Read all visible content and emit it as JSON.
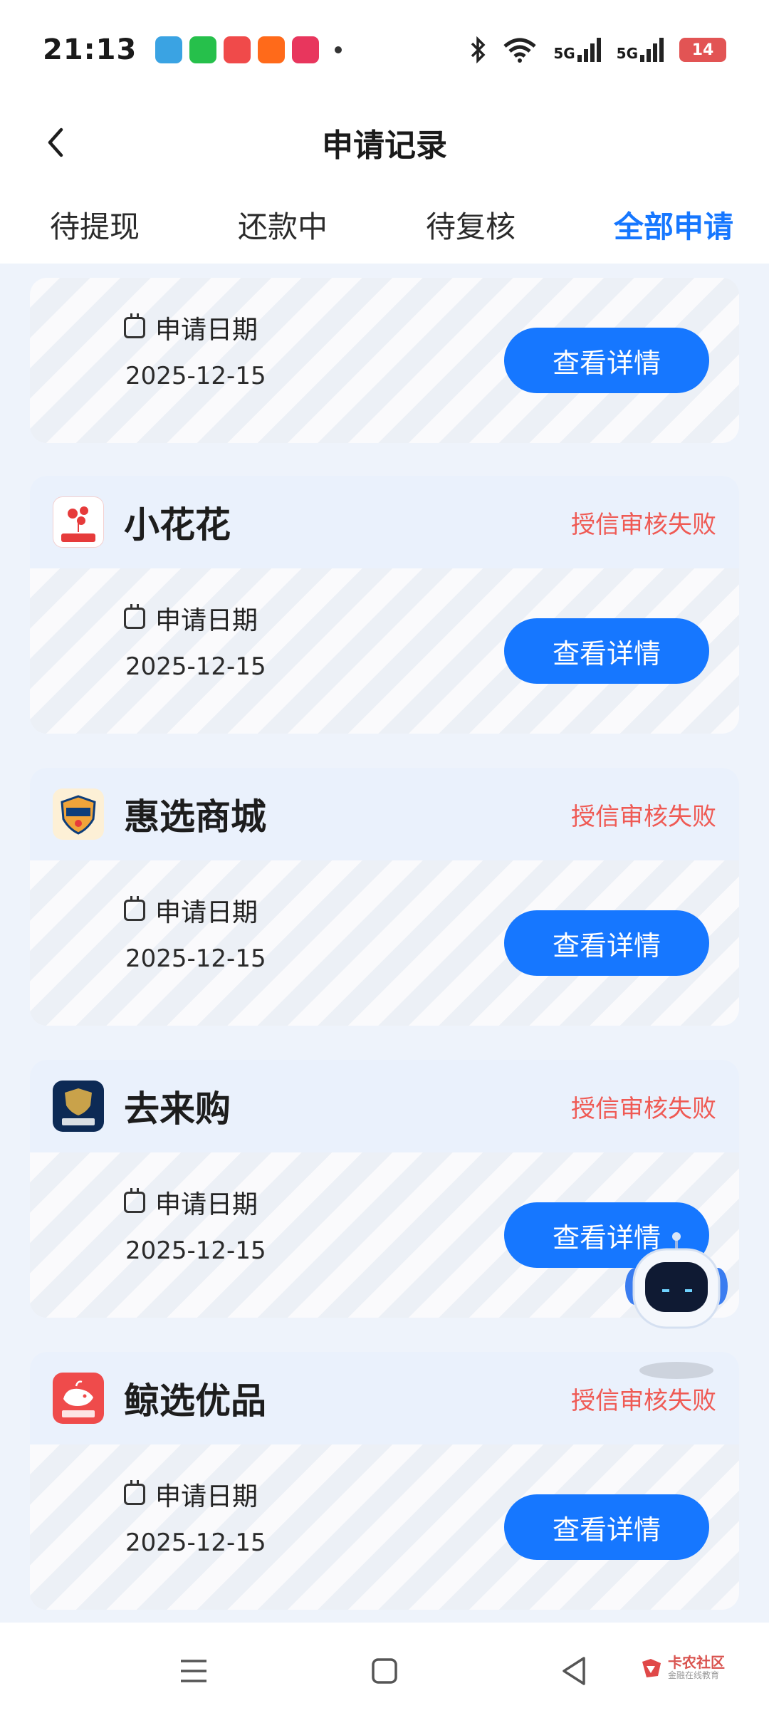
{
  "status_bar": {
    "time": "21:13",
    "network_1": "5G",
    "network_2": "5G",
    "battery": "14"
  },
  "nav": {
    "title": "申请记录"
  },
  "tabs": [
    {
      "label": "待提现",
      "active": false
    },
    {
      "label": "还款中",
      "active": false
    },
    {
      "label": "待复核",
      "active": false
    },
    {
      "label": "全部申请",
      "active": true
    }
  ],
  "records": [
    {
      "name": "",
      "status": "",
      "date_label": "申请日期",
      "date": "2025-12-15",
      "button": "查看详情"
    },
    {
      "name": "小花花",
      "status": "授信审核失败",
      "date_label": "申请日期",
      "date": "2025-12-15",
      "button": "查看详情",
      "logo_color": "#e63b3b"
    },
    {
      "name": "惠选商城",
      "status": "授信审核失败",
      "date_label": "申请日期",
      "date": "2025-12-15",
      "button": "查看详情",
      "logo_color": "#f0a43a"
    },
    {
      "name": "去来购",
      "status": "授信审核失败",
      "date_label": "申请日期",
      "date": "2025-12-15",
      "button": "查看详情",
      "logo_color": "#0d2a55"
    },
    {
      "name": "鲸选优品",
      "status": "授信审核失败",
      "date_label": "申请日期",
      "date": "2025-12-15",
      "button": "查看详情",
      "logo_color": "#ef4b4b"
    }
  ],
  "watermark": {
    "text": "卡农社区",
    "sub": "金融在线教育"
  },
  "colors": {
    "accent": "#1677ff",
    "fail": "#ef5a54",
    "background": "#eef3fb"
  }
}
